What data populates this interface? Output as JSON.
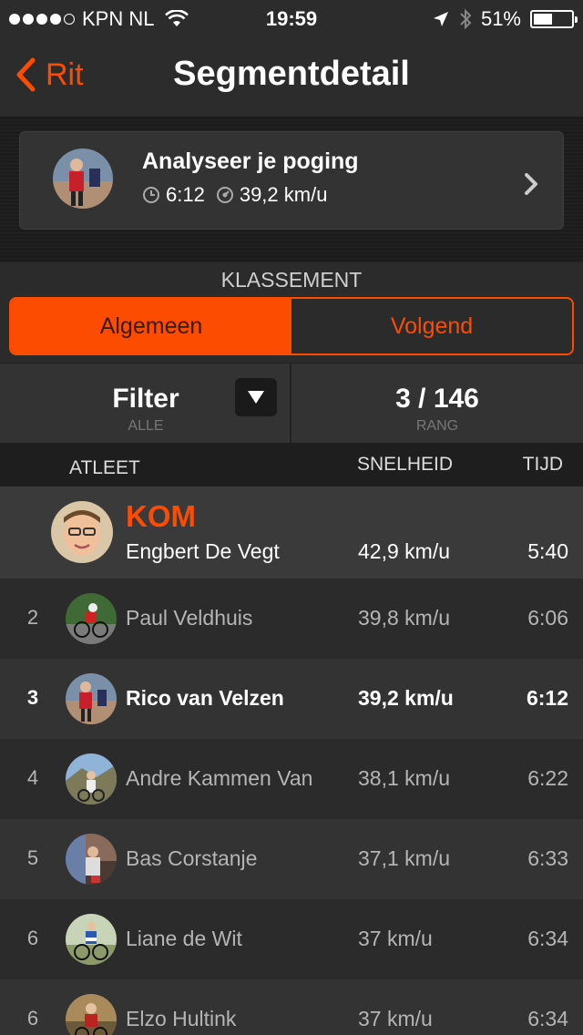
{
  "status_bar": {
    "carrier": "KPN NL",
    "time": "19:59",
    "battery_percent_text": "51%",
    "battery_level": 0.51
  },
  "nav": {
    "back_label": "Rit",
    "title": "Segmentdetail"
  },
  "analyze": {
    "title": "Analyseer je poging",
    "time": "6:12",
    "speed": "39,2 km/u"
  },
  "klassement": {
    "label": "KLASSEMENT",
    "tabs": [
      {
        "label": "Algemeen",
        "active": true
      },
      {
        "label": "Volgend",
        "active": false
      }
    ]
  },
  "filter": {
    "label": "Filter",
    "value": "ALLE",
    "rank": "3 / 146",
    "rank_label": "RANG"
  },
  "table": {
    "headers": {
      "athlete": "ATLEET",
      "speed": "SNELHEID",
      "time": "TIJD"
    },
    "kom": {
      "label": "KOM",
      "name": "Engbert De Vegt",
      "speed": "42,9 km/u",
      "time": "5:40"
    },
    "rows": [
      {
        "rank": "2",
        "name": "Paul Veldhuis",
        "speed": "39,8 km/u",
        "time": "6:06"
      },
      {
        "rank": "3",
        "name": "Rico van Velzen",
        "speed": "39,2 km/u",
        "time": "6:12",
        "current_user": true
      },
      {
        "rank": "4",
        "name": "Andre Kammen Van",
        "speed": "38,1 km/u",
        "time": "6:22"
      },
      {
        "rank": "5",
        "name": "Bas Corstanje",
        "speed": "37,1 km/u",
        "time": "6:33"
      },
      {
        "rank": "6",
        "name": "Liane de Wit",
        "speed": "37 km/u",
        "time": "6:34"
      },
      {
        "rank": "6",
        "name": "Elzo Hultink",
        "speed": "37 km/u",
        "time": "6:34"
      }
    ]
  },
  "colors": {
    "accent": "#fc4c02",
    "background": "#2b2b2b"
  }
}
